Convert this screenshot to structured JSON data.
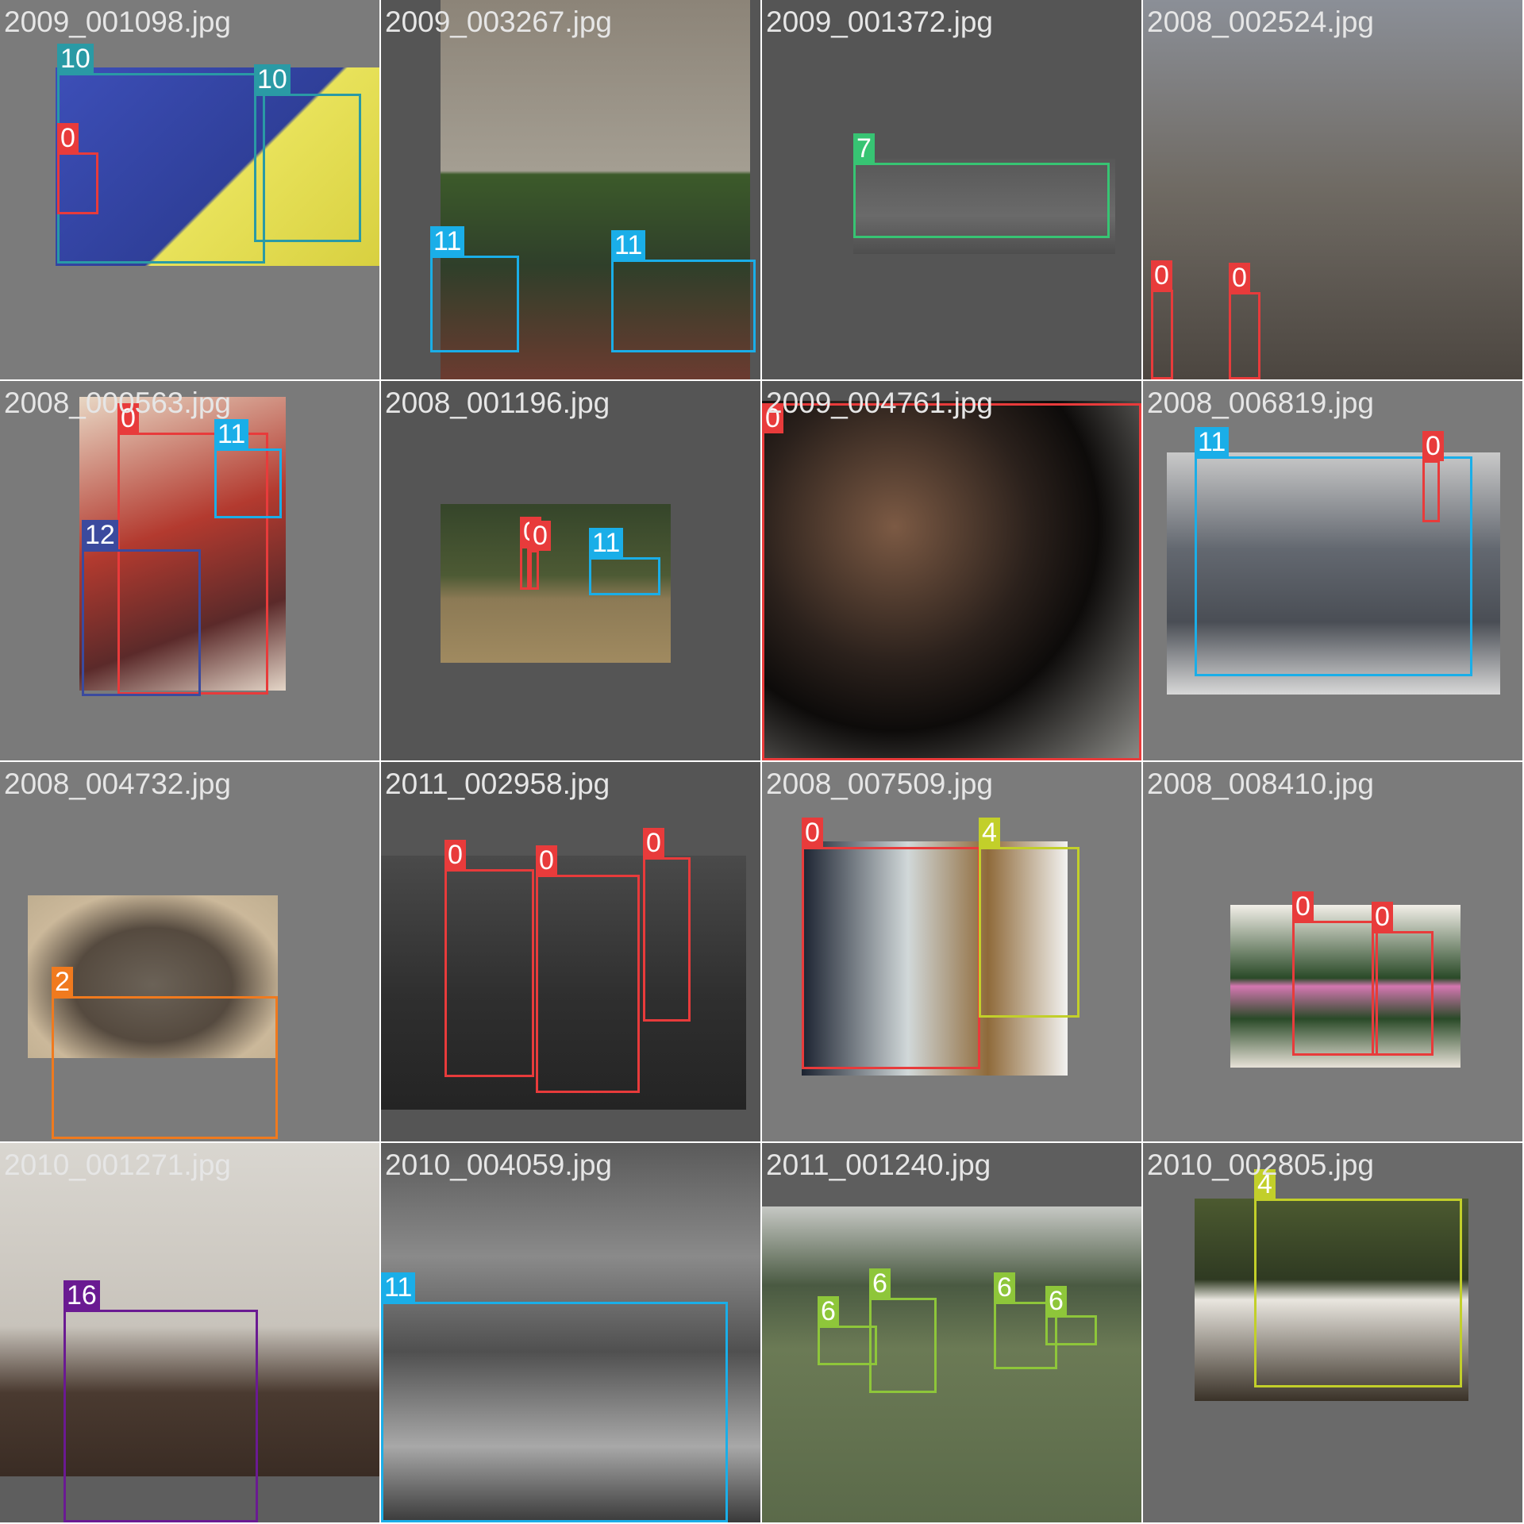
{
  "class_colors": {
    "0": "#e83b3b",
    "2": "#f07a1e",
    "4": "#c2cf2a",
    "6": "#8ec63a",
    "7": "#37c473",
    "10": "#2a9aa5",
    "11": "#1aaee8",
    "12": "#3b4a9e",
    "16": "#6a1a92"
  },
  "tiles": [
    {
      "filename": "2009_001098.jpg",
      "boxes": [
        {
          "label": "10"
        },
        {
          "label": "10"
        },
        {
          "label": "0"
        }
      ]
    },
    {
      "filename": "2009_003267.jpg",
      "boxes": [
        {
          "label": "11"
        },
        {
          "label": "11"
        }
      ]
    },
    {
      "filename": "2009_001372.jpg",
      "boxes": [
        {
          "label": "7"
        }
      ]
    },
    {
      "filename": "2008_002524.jpg",
      "boxes": [
        {
          "label": "0"
        },
        {
          "label": "0"
        }
      ]
    },
    {
      "filename": "2008_000563.jpg",
      "boxes": [
        {
          "label": "0"
        },
        {
          "label": "11"
        },
        {
          "label": "12"
        }
      ]
    },
    {
      "filename": "2008_001196.jpg",
      "boxes": [
        {
          "label": "0"
        },
        {
          "label": "0"
        },
        {
          "label": "11"
        }
      ]
    },
    {
      "filename": "2009_004761.jpg",
      "boxes": [
        {
          "label": "0"
        }
      ]
    },
    {
      "filename": "2008_006819.jpg",
      "boxes": [
        {
          "label": "11"
        },
        {
          "label": "0"
        }
      ]
    },
    {
      "filename": "2008_004732.jpg",
      "boxes": [
        {
          "label": "2"
        }
      ]
    },
    {
      "filename": "2011_002958.jpg",
      "boxes": [
        {
          "label": "0"
        },
        {
          "label": "0"
        },
        {
          "label": "0"
        }
      ]
    },
    {
      "filename": "2008_007509.jpg",
      "boxes": [
        {
          "label": "0"
        },
        {
          "label": "4"
        }
      ]
    },
    {
      "filename": "2008_008410.jpg",
      "boxes": [
        {
          "label": "0"
        },
        {
          "label": "0"
        }
      ]
    },
    {
      "filename": "2010_001271.jpg",
      "boxes": [
        {
          "label": "16"
        }
      ]
    },
    {
      "filename": "2010_004059.jpg",
      "boxes": [
        {
          "label": "11"
        }
      ]
    },
    {
      "filename": "2011_001240.jpg",
      "boxes": [
        {
          "label": "6"
        },
        {
          "label": "6"
        },
        {
          "label": "6"
        },
        {
          "label": "6"
        }
      ]
    },
    {
      "filename": "2010_002805.jpg",
      "boxes": [
        {
          "label": "4"
        }
      ]
    }
  ]
}
